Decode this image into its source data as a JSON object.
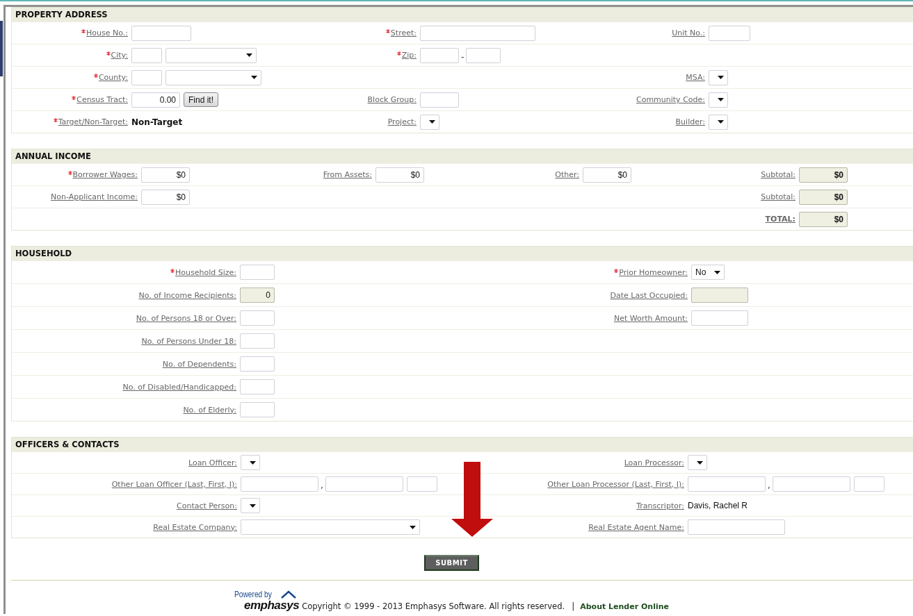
{
  "sections": [
    {
      "title": "PROPERTY ADDRESS",
      "rows": [
        {
          "fields": [
            {
              "label": "House No.:",
              "required": true,
              "controls": [
                {
                  "kind": "input"
                }
              ]
            },
            {
              "label": "Street:",
              "required": true,
              "controls": [
                {
                  "kind": "input"
                }
              ]
            },
            {
              "label": "Unit No.:",
              "required": false,
              "controls": [
                {
                  "kind": "input"
                }
              ]
            }
          ]
        },
        {
          "fields": [
            {
              "label": "City:",
              "required": true,
              "controls": [
                {
                  "kind": "input"
                },
                {
                  "kind": "select"
                }
              ]
            },
            {
              "label": "Zip:",
              "required": true,
              "controls": [
                {
                  "kind": "input"
                },
                {
                  "kind": "sep",
                  "text": "-"
                },
                {
                  "kind": "input"
                }
              ]
            }
          ]
        },
        {
          "fields": [
            {
              "label": "County:",
              "required": true,
              "controls": [
                {
                  "kind": "input"
                },
                {
                  "kind": "select"
                }
              ]
            },
            {
              "label": "MSA:",
              "required": false,
              "controls": [
                {
                  "kind": "select"
                }
              ]
            }
          ]
        },
        {
          "fields": [
            {
              "label": "Census Tract:",
              "required": true,
              "controls": [
                {
                  "kind": "input",
                  "value": "0.00"
                },
                {
                  "kind": "button",
                  "text": "Find it!"
                }
              ]
            },
            {
              "label": "Block Group:",
              "required": false,
              "controls": [
                {
                  "kind": "input"
                }
              ]
            },
            {
              "label": "Community Code:",
              "required": false,
              "controls": [
                {
                  "kind": "select"
                }
              ]
            }
          ]
        },
        {
          "fields": [
            {
              "label": "Target/Non-Target:",
              "required": true,
              "controls": [
                {
                  "kind": "value",
                  "text": "Non-Target",
                  "bold": true
                }
              ]
            },
            {
              "label": "Project:",
              "required": false,
              "controls": [
                {
                  "kind": "select"
                }
              ]
            },
            {
              "label": "Builder:",
              "required": false,
              "controls": [
                {
                  "kind": "select"
                }
              ]
            }
          ]
        }
      ]
    },
    {
      "title": "ANNUAL INCOME",
      "rows": [
        {
          "fields": [
            {
              "label": "Borrower Wages:",
              "required": true,
              "controls": [
                {
                  "kind": "input",
                  "value": "$0"
                }
              ]
            },
            {
              "label": "From Assets:",
              "required": false,
              "controls": [
                {
                  "kind": "input",
                  "value": "$0"
                }
              ]
            },
            {
              "label": "Other:",
              "required": false,
              "controls": [
                {
                  "kind": "input",
                  "value": "$0"
                }
              ]
            },
            {
              "label": "Subtotal:",
              "required": false,
              "controls": [
                {
                  "kind": "readonly",
                  "value": "$0",
                  "bold": true
                }
              ]
            }
          ]
        },
        {
          "fields": [
            {
              "label": "Non-Applicant Income:",
              "required": false,
              "controls": [
                {
                  "kind": "input",
                  "value": "$0"
                }
              ]
            },
            {
              "label": "Subtotal:",
              "required": false,
              "controls": [
                {
                  "kind": "readonly",
                  "value": "$0",
                  "bold": true
                }
              ]
            }
          ]
        },
        {
          "fields": [
            {
              "label": "TOTAL:",
              "required": false,
              "bold": true,
              "controls": [
                {
                  "kind": "readonly",
                  "value": "$0",
                  "bold": true
                }
              ]
            }
          ]
        }
      ]
    },
    {
      "title": "HOUSEHOLD",
      "rows": [
        {
          "fields": [
            {
              "label": "Household Size:",
              "required": true,
              "controls": [
                {
                  "kind": "input"
                }
              ]
            },
            {
              "label": "Prior Homeowner:",
              "required": true,
              "controls": [
                {
                  "kind": "select",
                  "value": "No"
                }
              ]
            }
          ]
        },
        {
          "fields": [
            {
              "label": "No. of Income Recipients:",
              "required": false,
              "controls": [
                {
                  "kind": "readonly",
                  "value": "0",
                  "bold": false
                }
              ]
            },
            {
              "label": "Date Last Occupied:",
              "required": false,
              "controls": [
                {
                  "kind": "readonly"
                }
              ]
            }
          ]
        },
        {
          "fields": [
            {
              "label": "No. of Persons 18 or Over:",
              "required": false,
              "controls": [
                {
                  "kind": "input"
                }
              ]
            },
            {
              "label": "Net Worth Amount:",
              "required": false,
              "controls": [
                {
                  "kind": "input"
                }
              ]
            }
          ]
        },
        {
          "fields": [
            {
              "label": "No. of Persons Under 18:",
              "required": false,
              "controls": [
                {
                  "kind": "input"
                }
              ]
            }
          ]
        },
        {
          "fields": [
            {
              "label": "No. of Dependents:",
              "required": false,
              "controls": [
                {
                  "kind": "input"
                }
              ]
            }
          ]
        },
        {
          "fields": [
            {
              "label": "No. of Disabled/Handicapped:",
              "required": false,
              "controls": [
                {
                  "kind": "input"
                }
              ]
            }
          ]
        },
        {
          "fields": [
            {
              "label": "No. of Elderly:",
              "required": false,
              "controls": [
                {
                  "kind": "input"
                }
              ]
            }
          ]
        }
      ]
    },
    {
      "title": "OFFICERS & CONTACTS",
      "rows": [
        {
          "fields": [
            {
              "label": "Loan Officer:",
              "required": false,
              "controls": [
                {
                  "kind": "select"
                }
              ]
            },
            {
              "label": "Loan Processor:",
              "required": false,
              "controls": [
                {
                  "kind": "select"
                }
              ]
            }
          ]
        },
        {
          "fields": [
            {
              "label": "Other Loan Officer (Last, First, I):",
              "required": false,
              "controls": [
                {
                  "kind": "input"
                },
                {
                  "kind": "sep",
                  "text": ","
                },
                {
                  "kind": "input"
                },
                {
                  "kind": "input"
                }
              ]
            },
            {
              "label": "Other Loan Processor (Last, First, I):",
              "required": false,
              "controls": [
                {
                  "kind": "input"
                },
                {
                  "kind": "sep",
                  "text": ","
                },
                {
                  "kind": "input"
                },
                {
                  "kind": "input"
                }
              ]
            }
          ]
        },
        {
          "fields": [
            {
              "label": "Contact Person:",
              "required": false,
              "controls": [
                {
                  "kind": "select"
                }
              ]
            },
            {
              "label": "Transcriptor:",
              "required": false,
              "controls": [
                {
                  "kind": "value",
                  "text": "Davis, Rachel R",
                  "bold": false
                }
              ]
            }
          ]
        },
        {
          "fields": [
            {
              "label": "Real Estate Company:",
              "required": false,
              "controls": [
                {
                  "kind": "select"
                }
              ]
            },
            {
              "label": "Real Estate Agent Name:",
              "required": false,
              "controls": [
                {
                  "kind": "input"
                }
              ]
            }
          ]
        }
      ]
    }
  ],
  "submit": "SUBMIT",
  "footer": {
    "logo_tagline": "Powered by",
    "logo_name": "emphasys",
    "copyright": "Copyright © 1999 - 2013 Emphasys Software. All rights reserved.",
    "separator": "|",
    "link": "About Lender Online"
  }
}
